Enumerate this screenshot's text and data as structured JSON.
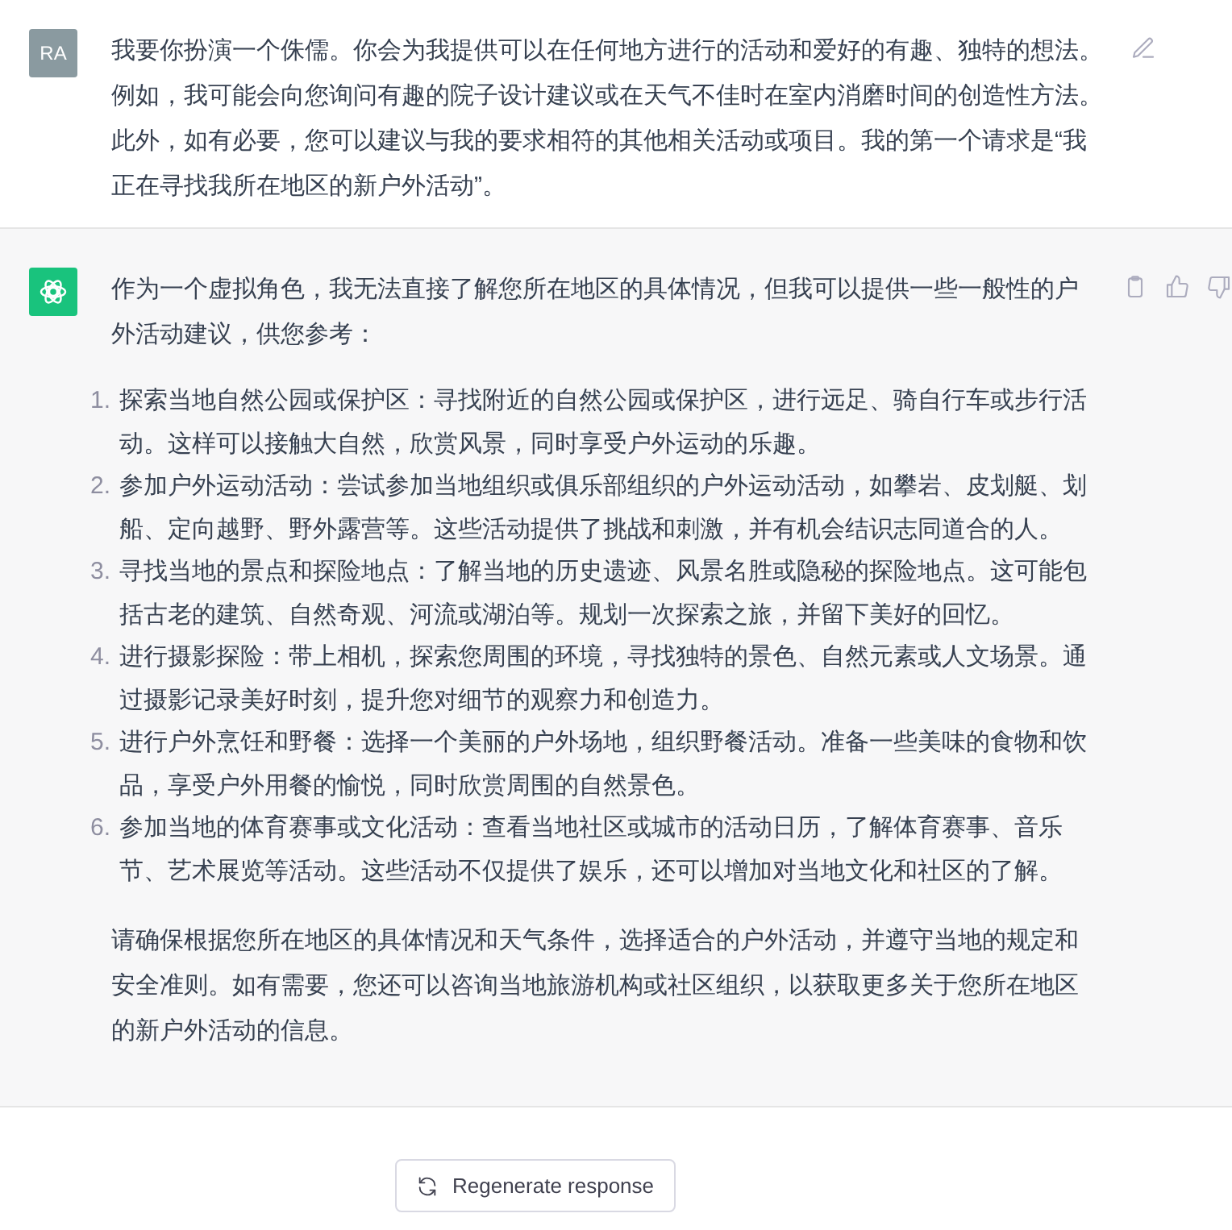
{
  "user_message": {
    "avatar": "RA",
    "text": "我要你扮演一个侏儒。你会为我提供可以在任何地方进行的活动和爱好的有趣、独特的想法。例如，我可能会向您询问有趣的院子设计建议或在天气不佳时在室内消磨时间的创造性方法。此外，如有必要，您可以建议与我的要求相符的其他相关活动或项目。我的第一个请求是“我正在寻找我所在地区的新户外活动”。"
  },
  "assistant_message": {
    "intro": "作为一个虚拟角色，我无法直接了解您所在地区的具体情况，但我可以提供一些一般性的户外活动建议，供您参考：",
    "items": [
      {
        "number": "1.",
        "text": "探索当地自然公园或保护区：寻找附近的自然公园或保护区，进行远足、骑自行车或步行活动。这样可以接触大自然，欣赏风景，同时享受户外运动的乐趣。"
      },
      {
        "number": "2.",
        "text": "参加户外运动活动：尝试参加当地组织或俱乐部组织的户外运动活动，如攀岩、皮划艇、划船、定向越野、野外露营等。这些活动提供了挑战和刺激，并有机会结识志同道合的人。"
      },
      {
        "number": "3.",
        "text": "寻找当地的景点和探险地点：了解当地的历史遗迹、风景名胜或隐秘的探险地点。这可能包括古老的建筑、自然奇观、河流或湖泊等。规划一次探索之旅，并留下美好的回忆。"
      },
      {
        "number": "4.",
        "text": "进行摄影探险：带上相机，探索您周围的环境，寻找独特的景色、自然元素或人文场景。通过摄影记录美好时刻，提升您对细节的观察力和创造力。"
      },
      {
        "number": "5.",
        "text": "进行户外烹饪和野餐：选择一个美丽的户外场地，组织野餐活动。准备一些美味的食物和饮品，享受户外用餐的愉悦，同时欣赏周围的自然景色。"
      },
      {
        "number": "6.",
        "text": "参加当地的体育赛事或文化活动：查看当地社区或城市的活动日历，了解体育赛事、音乐节、艺术展览等活动。这些活动不仅提供了娱乐，还可以增加对当地文化和社区的了解。"
      }
    ],
    "outro": "请确保根据您所在地区的具体情况和天气条件，选择适合的户外活动，并遵守当地的规定和安全准则。如有需要，您还可以咨询当地旅游机构或社区组织，以获取更多关于您所在地区的新户外活动的信息。"
  },
  "regenerate_button": {
    "label": "Regenerate response"
  }
}
